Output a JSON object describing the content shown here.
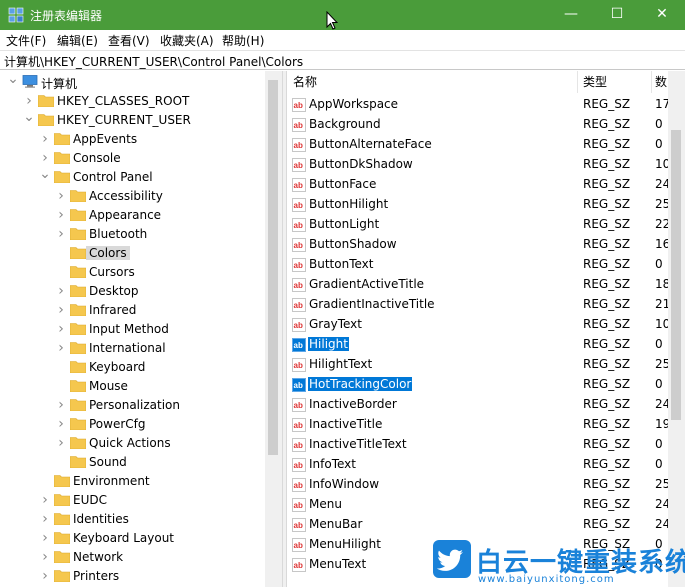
{
  "window": {
    "title": "注册表编辑器",
    "controls": {
      "minimize": "—",
      "maximize": "☐",
      "close": "✕"
    }
  },
  "menubar": {
    "items": [
      {
        "label": "文件(F)"
      },
      {
        "label": "编辑(E)"
      },
      {
        "label": "查看(V)"
      },
      {
        "label": "收藏夹(A)"
      },
      {
        "label": "帮助(H)"
      }
    ]
  },
  "address": {
    "path": "计算机\\HKEY_CURRENT_USER\\Control Panel\\Colors"
  },
  "tree": {
    "nodes": [
      {
        "label": "计算机",
        "depth": 0,
        "expanded": true,
        "icon": "computer-icon"
      },
      {
        "label": "HKEY_CLASSES_ROOT",
        "depth": 1,
        "expanded": false
      },
      {
        "label": "HKEY_CURRENT_USER",
        "depth": 1,
        "expanded": true
      },
      {
        "label": "AppEvents",
        "depth": 2,
        "expanded": false
      },
      {
        "label": "Console",
        "depth": 2,
        "expanded": false
      },
      {
        "label": "Control Panel",
        "depth": 2,
        "expanded": true
      },
      {
        "label": "Accessibility",
        "depth": 3,
        "expanded": false
      },
      {
        "label": "Appearance",
        "depth": 3,
        "expanded": false
      },
      {
        "label": "Bluetooth",
        "depth": 3,
        "expanded": false
      },
      {
        "label": "Colors",
        "depth": 3,
        "expanded": false,
        "selected": true,
        "leaf": true
      },
      {
        "label": "Cursors",
        "depth": 3,
        "expanded": false,
        "leaf": true
      },
      {
        "label": "Desktop",
        "depth": 3,
        "expanded": false
      },
      {
        "label": "Infrared",
        "depth": 3,
        "expanded": false
      },
      {
        "label": "Input Method",
        "depth": 3,
        "expanded": false
      },
      {
        "label": "International",
        "depth": 3,
        "expanded": false
      },
      {
        "label": "Keyboard",
        "depth": 3,
        "expanded": false,
        "leaf": true
      },
      {
        "label": "Mouse",
        "depth": 3,
        "expanded": false,
        "leaf": true
      },
      {
        "label": "Personalization",
        "depth": 3,
        "expanded": false
      },
      {
        "label": "PowerCfg",
        "depth": 3,
        "expanded": false
      },
      {
        "label": "Quick Actions",
        "depth": 3,
        "expanded": false
      },
      {
        "label": "Sound",
        "depth": 3,
        "expanded": false,
        "leaf": true
      },
      {
        "label": "Environment",
        "depth": 2,
        "expanded": false,
        "leaf": true
      },
      {
        "label": "EUDC",
        "depth": 2,
        "expanded": false
      },
      {
        "label": "Identities",
        "depth": 2,
        "expanded": false
      },
      {
        "label": "Keyboard Layout",
        "depth": 2,
        "expanded": false
      },
      {
        "label": "Network",
        "depth": 2,
        "expanded": false
      },
      {
        "label": "Printers",
        "depth": 2,
        "expanded": false
      }
    ]
  },
  "list": {
    "columns": {
      "name": "名称",
      "type": "类型",
      "data": "数"
    },
    "rows": [
      {
        "name": "AppWorkspace",
        "type": "REG_SZ",
        "data": "17"
      },
      {
        "name": "Background",
        "type": "REG_SZ",
        "data": "0"
      },
      {
        "name": "ButtonAlternateFace",
        "type": "REG_SZ",
        "data": "0"
      },
      {
        "name": "ButtonDkShadow",
        "type": "REG_SZ",
        "data": "10"
      },
      {
        "name": "ButtonFace",
        "type": "REG_SZ",
        "data": "24"
      },
      {
        "name": "ButtonHilight",
        "type": "REG_SZ",
        "data": "25"
      },
      {
        "name": "ButtonLight",
        "type": "REG_SZ",
        "data": "22"
      },
      {
        "name": "ButtonShadow",
        "type": "REG_SZ",
        "data": "16"
      },
      {
        "name": "ButtonText",
        "type": "REG_SZ",
        "data": "0"
      },
      {
        "name": "GradientActiveTitle",
        "type": "REG_SZ",
        "data": "18"
      },
      {
        "name": "GradientInactiveTitle",
        "type": "REG_SZ",
        "data": "21"
      },
      {
        "name": "GrayText",
        "type": "REG_SZ",
        "data": "10"
      },
      {
        "name": "Hilight",
        "type": "REG_SZ",
        "data": "0",
        "selected": true
      },
      {
        "name": "HilightText",
        "type": "REG_SZ",
        "data": "25"
      },
      {
        "name": "HotTrackingColor",
        "type": "REG_SZ",
        "data": "0",
        "selected": true
      },
      {
        "name": "InactiveBorder",
        "type": "REG_SZ",
        "data": "24"
      },
      {
        "name": "InactiveTitle",
        "type": "REG_SZ",
        "data": "19"
      },
      {
        "name": "InactiveTitleText",
        "type": "REG_SZ",
        "data": "0"
      },
      {
        "name": "InfoText",
        "type": "REG_SZ",
        "data": "0"
      },
      {
        "name": "InfoWindow",
        "type": "REG_SZ",
        "data": "25"
      },
      {
        "name": "Menu",
        "type": "REG_SZ",
        "data": "24"
      },
      {
        "name": "MenuBar",
        "type": "REG_SZ",
        "data": "24"
      },
      {
        "name": "MenuHilight",
        "type": "REG_SZ",
        "data": "0"
      },
      {
        "name": "MenuText",
        "type": "REG_SZ",
        "data": "0"
      }
    ]
  },
  "watermark": {
    "title": "白云一键重装系统",
    "url": "www.baiyunxitong.com"
  },
  "colors": {
    "titlebar": "#4a9c3a",
    "selection": "#0078d7",
    "folder": "#f5c74e",
    "watermark": "#1a82d9"
  }
}
